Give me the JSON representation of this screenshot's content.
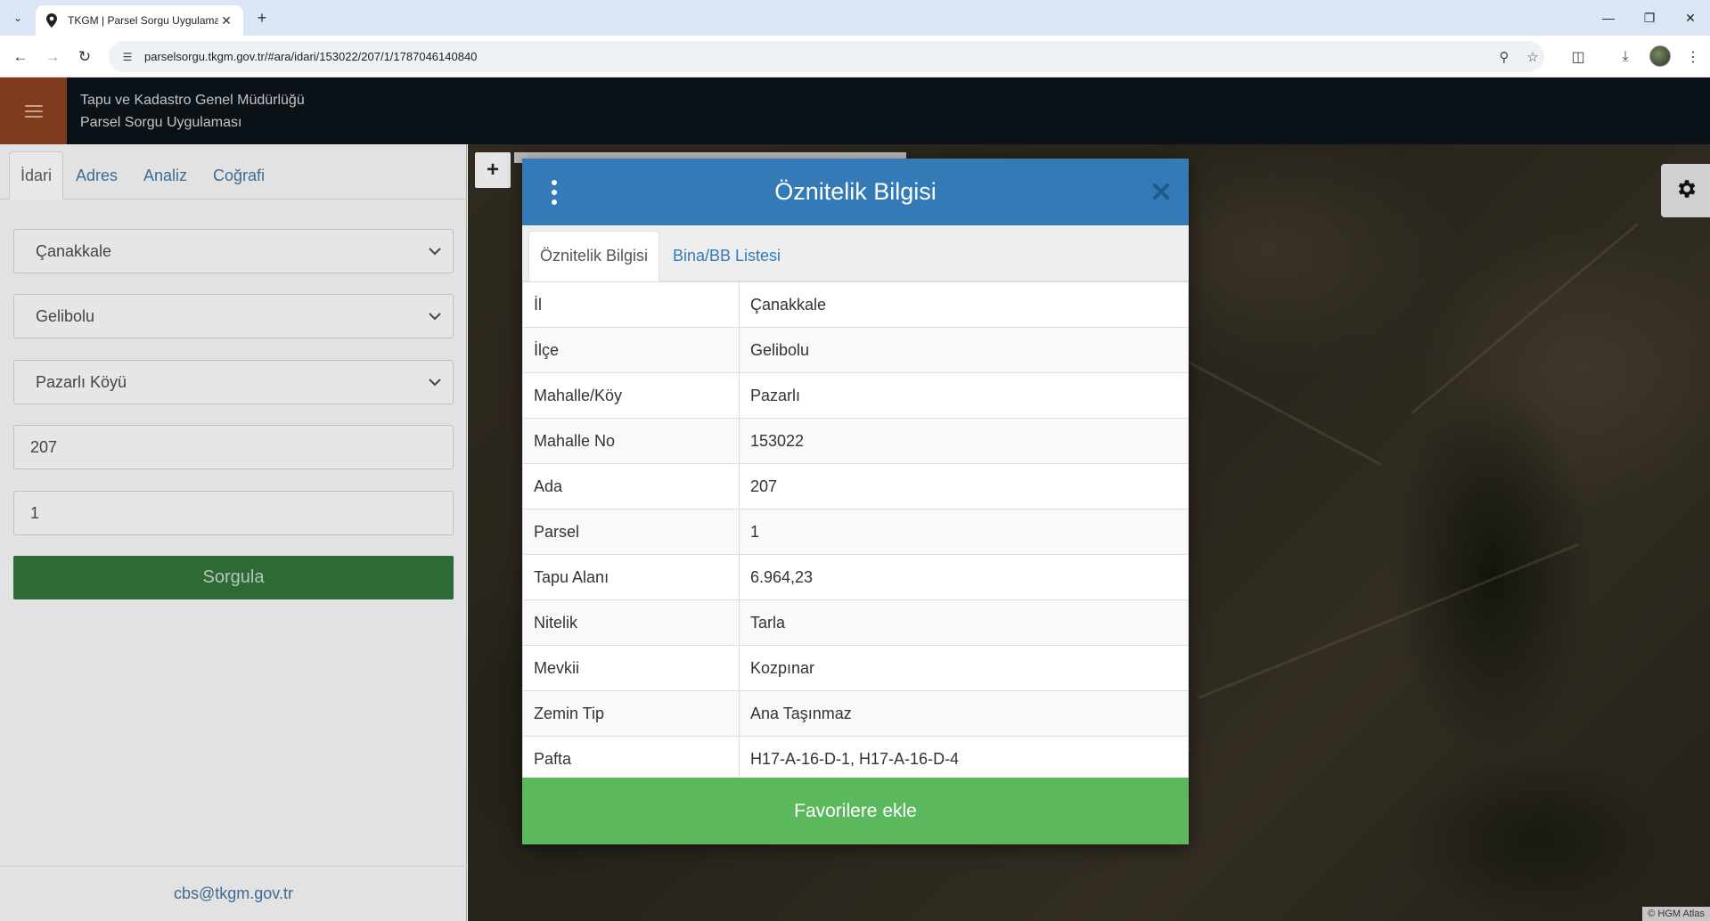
{
  "browser": {
    "tab_title": "TKGM | Parsel Sorgu Uygulaması",
    "url": "parselsorgu.tkgm.gov.tr/#ara/idari/153022/207/1/1787046140840"
  },
  "header": {
    "org": "Tapu ve Kadastro Genel Müdürlüğü",
    "app": "Parsel Sorgu Uygulaması"
  },
  "left_panel": {
    "tabs": [
      {
        "label": "İdari"
      },
      {
        "label": "Adres"
      },
      {
        "label": "Analiz"
      },
      {
        "label": "Coğrafi"
      }
    ],
    "il": "Çanakkale",
    "ilce": "Gelibolu",
    "mahalle": "Pazarlı Köyü",
    "ada": "207",
    "parsel": "1",
    "submit_label": "Sorgula",
    "footer_email": "cbs@tkgm.gov.tr"
  },
  "map": {
    "zoom_in": "+",
    "attribution": "© HGM Atlas"
  },
  "modal": {
    "title": "Öznitelik Bilgisi",
    "tabs": [
      {
        "label": "Öznitelik Bilgisi"
      },
      {
        "label": "Bina/BB Listesi"
      }
    ],
    "rows": [
      {
        "key": "İl",
        "value": "Çanakkale"
      },
      {
        "key": "İlçe",
        "value": "Gelibolu"
      },
      {
        "key": "Mahalle/Köy",
        "value": "Pazarlı"
      },
      {
        "key": "Mahalle No",
        "value": "153022"
      },
      {
        "key": "Ada",
        "value": "207"
      },
      {
        "key": "Parsel",
        "value": "1"
      },
      {
        "key": "Tapu Alanı",
        "value": "6.964,23"
      },
      {
        "key": "Nitelik",
        "value": "Tarla"
      },
      {
        "key": "Mevkii",
        "value": "Kozpınar"
      },
      {
        "key": "Zemin Tip",
        "value": "Ana Taşınmaz"
      },
      {
        "key": "Pafta",
        "value": "H17-A-16-D-1, H17-A-16-D-4"
      }
    ],
    "favorite_label": "Favorilere ekle"
  }
}
